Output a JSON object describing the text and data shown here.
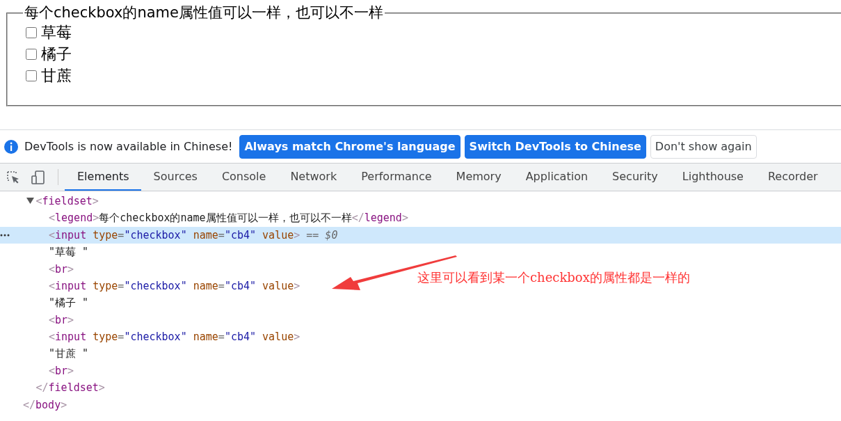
{
  "page": {
    "fieldset": {
      "legend": "每个checkbox的name属性值可以一样，也可以不一样",
      "checkboxes": [
        {
          "label": "草莓",
          "checked": false
        },
        {
          "label": "橘子",
          "checked": false
        },
        {
          "label": "甘蔗",
          "checked": false
        }
      ]
    }
  },
  "infobar": {
    "message": "DevTools is now available in Chinese!",
    "buttons": [
      {
        "label": "Always match Chrome's language",
        "kind": "primary"
      },
      {
        "label": "Switch DevTools to Chinese",
        "kind": "primary"
      },
      {
        "label": "Don't show again",
        "kind": "secondary"
      }
    ]
  },
  "tabs": [
    {
      "label": "Elements",
      "selected": true
    },
    {
      "label": "Sources",
      "selected": false
    },
    {
      "label": "Console",
      "selected": false
    },
    {
      "label": "Network",
      "selected": false
    },
    {
      "label": "Performance",
      "selected": false
    },
    {
      "label": "Memory",
      "selected": false
    },
    {
      "label": "Application",
      "selected": false
    },
    {
      "label": "Security",
      "selected": false
    },
    {
      "label": "Lighthouse",
      "selected": false
    },
    {
      "label": "Recorder",
      "selected": false
    }
  ],
  "dom": {
    "children": [
      {
        "tokens": [
          {
            "kind": "bracket",
            "text": "<"
          },
          {
            "kind": "tag",
            "text": "fieldset"
          },
          {
            "kind": "bracket",
            "text": ">"
          }
        ],
        "selected": false,
        "expanded": true,
        "children": [
          {
            "tokens": [
              {
                "kind": "bracket",
                "text": "<"
              },
              {
                "kind": "tag",
                "text": "legend"
              },
              {
                "kind": "bracket",
                "text": ">"
              },
              {
                "kind": "text",
                "text": "每个checkbox的name属性值可以一样，也可以不一样"
              },
              {
                "kind": "bracket",
                "text": "</"
              },
              {
                "kind": "tag",
                "text": "legend"
              },
              {
                "kind": "bracket",
                "text": ">"
              }
            ],
            "selected": false
          },
          {
            "tokens": [
              {
                "kind": "bracket",
                "text": "<"
              },
              {
                "kind": "tag",
                "text": "input"
              },
              {
                "kind": "attr",
                "text": " type"
              },
              {
                "kind": "eq",
                "text": "="
              },
              {
                "kind": "value",
                "text": "\"checkbox\""
              },
              {
                "kind": "attr",
                "text": " name"
              },
              {
                "kind": "eq",
                "text": "="
              },
              {
                "kind": "value",
                "text": "\"cb4\""
              },
              {
                "kind": "attr",
                "text": " value"
              },
              {
                "kind": "bracket",
                "text": ">"
              },
              {
                "kind": "ref",
                "text": " == $0"
              }
            ],
            "selected": true
          },
          {
            "tokens": [
              {
                "kind": "text",
                "text": "\"草莓 \""
              }
            ],
            "selected": false
          },
          {
            "tokens": [
              {
                "kind": "bracket",
                "text": "<"
              },
              {
                "kind": "tag",
                "text": "br"
              },
              {
                "kind": "bracket",
                "text": ">"
              }
            ],
            "selected": false
          },
          {
            "tokens": [
              {
                "kind": "bracket",
                "text": "<"
              },
              {
                "kind": "tag",
                "text": "input"
              },
              {
                "kind": "attr",
                "text": " type"
              },
              {
                "kind": "eq",
                "text": "="
              },
              {
                "kind": "value",
                "text": "\"checkbox\""
              },
              {
                "kind": "attr",
                "text": " name"
              },
              {
                "kind": "eq",
                "text": "="
              },
              {
                "kind": "value",
                "text": "\"cb4\""
              },
              {
                "kind": "attr",
                "text": " value"
              },
              {
                "kind": "bracket",
                "text": ">"
              }
            ],
            "selected": false
          },
          {
            "tokens": [
              {
                "kind": "text",
                "text": "\"橘子 \""
              }
            ],
            "selected": false
          },
          {
            "tokens": [
              {
                "kind": "bracket",
                "text": "<"
              },
              {
                "kind": "tag",
                "text": "br"
              },
              {
                "kind": "bracket",
                "text": ">"
              }
            ],
            "selected": false
          },
          {
            "tokens": [
              {
                "kind": "bracket",
                "text": "<"
              },
              {
                "kind": "tag",
                "text": "input"
              },
              {
                "kind": "attr",
                "text": " type"
              },
              {
                "kind": "eq",
                "text": "="
              },
              {
                "kind": "value",
                "text": "\"checkbox\""
              },
              {
                "kind": "attr",
                "text": " name"
              },
              {
                "kind": "eq",
                "text": "="
              },
              {
                "kind": "value",
                "text": "\"cb4\""
              },
              {
                "kind": "attr",
                "text": " value"
              },
              {
                "kind": "bracket",
                "text": ">"
              }
            ],
            "selected": false
          },
          {
            "tokens": [
              {
                "kind": "text",
                "text": "\"甘蔗 \""
              }
            ],
            "selected": false
          },
          {
            "tokens": [
              {
                "kind": "bracket",
                "text": "<"
              },
              {
                "kind": "tag",
                "text": "br"
              },
              {
                "kind": "bracket",
                "text": ">"
              }
            ],
            "selected": false
          }
        ]
      },
      {
        "tokens": [
          {
            "kind": "bracket",
            "text": "</"
          },
          {
            "kind": "tag",
            "text": "fieldset"
          },
          {
            "kind": "bracket",
            "text": ">"
          }
        ],
        "selected": false
      }
    ],
    "close": [
      {
        "kind": "bracket",
        "text": "</"
      },
      {
        "kind": "tag",
        "text": "body"
      },
      {
        "kind": "bracket",
        "text": ">"
      }
    ]
  },
  "annotation": {
    "text": "这里可以看到某一个checkbox的属性都是一样的"
  }
}
